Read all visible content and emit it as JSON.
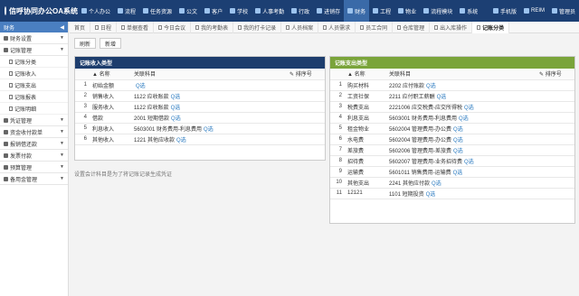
{
  "app": {
    "title": "信呼协同办公OA系统"
  },
  "topnav": {
    "items": [
      {
        "label": "个人办公",
        "active": false
      },
      {
        "label": "流程",
        "active": false
      },
      {
        "label": "任务资源",
        "active": false
      },
      {
        "label": "公文",
        "active": false
      },
      {
        "label": "客户",
        "active": false
      },
      {
        "label": "学校",
        "active": false
      },
      {
        "label": "人事考勤",
        "active": false
      },
      {
        "label": "行政",
        "active": false
      },
      {
        "label": "进销存",
        "active": false
      },
      {
        "label": "财务",
        "active": true
      },
      {
        "label": "工程",
        "active": false
      },
      {
        "label": "物业",
        "active": false
      },
      {
        "label": "流程模块",
        "active": false
      },
      {
        "label": "系统",
        "active": false
      }
    ],
    "right": [
      "手机版",
      "REIM",
      "管理员"
    ]
  },
  "sidebar": {
    "header": "财务",
    "groups": [
      {
        "label": "财务设置"
      },
      {
        "label": "记账管理",
        "children": [
          "记账分类",
          "记账收入",
          "记账支出",
          "记账报表",
          "记账明细"
        ]
      },
      {
        "label": "凭证管理"
      },
      {
        "label": "资金收付款单"
      },
      {
        "label": "报销借还款"
      },
      {
        "label": "发票付款"
      },
      {
        "label": "预算管理"
      },
      {
        "label": "备用金管理"
      }
    ]
  },
  "tabs": [
    "首页",
    "日程",
    "单据查看",
    "今日会议",
    "我的考勤表",
    "我的打卡记录",
    "人员档案",
    "人员需求",
    "员工合同",
    "仓库管理",
    "出入库操作",
    "记账分类"
  ],
  "active_tab": 11,
  "toolbar": {
    "refresh": "刷新",
    "add": "新增"
  },
  "income": {
    "title": "记账收入类型",
    "headers": [
      "名称",
      "关联科目",
      "排序号"
    ],
    "rows": [
      {
        "no": "1",
        "name": "初始金额",
        "subject": ""
      },
      {
        "no": "2",
        "name": "销售收入",
        "subject": "1122 应收账款"
      },
      {
        "no": "3",
        "name": "服务收入",
        "subject": "1122 应收账款"
      },
      {
        "no": "4",
        "name": "借款",
        "subject": "2001 短期借款"
      },
      {
        "no": "5",
        "name": "利息收入",
        "subject": "5603001 财务费用-利息费用"
      },
      {
        "no": "6",
        "name": "其他收入",
        "subject": "1221 其他应收款"
      }
    ]
  },
  "expense": {
    "title": "记账支出类型",
    "headers": [
      "名称",
      "关联科目",
      "排序号"
    ],
    "rows": [
      {
        "no": "1",
        "name": "购买材料",
        "subject": "2202 应付账款"
      },
      {
        "no": "2",
        "name": "工资社保",
        "subject": "2211 应付职工薪酬"
      },
      {
        "no": "3",
        "name": "税费支出",
        "subject": "2221006 应交税费-应交所得税"
      },
      {
        "no": "4",
        "name": "利息支出",
        "subject": "5603001 财务费用-利息费用"
      },
      {
        "no": "5",
        "name": "租金物业",
        "subject": "5602004 管理费用-办公费"
      },
      {
        "no": "6",
        "name": "水电费",
        "subject": "5602004 管理费用-办公费"
      },
      {
        "no": "7",
        "name": "差旅费",
        "subject": "5602006 管理费用-差旅费"
      },
      {
        "no": "8",
        "name": "招待费",
        "subject": "5602007 管理费用-业务招待费"
      },
      {
        "no": "9",
        "name": "运输费",
        "subject": "5601011 销售费用-运输费"
      },
      {
        "no": "10",
        "name": "其他支出",
        "subject": "2241 其他应付款"
      },
      {
        "no": "11",
        "name": "12121",
        "subject": "1101 短期投资"
      }
    ]
  },
  "select_label": "选",
  "note": "设置会计科目是为了将记账记录生成凭证"
}
